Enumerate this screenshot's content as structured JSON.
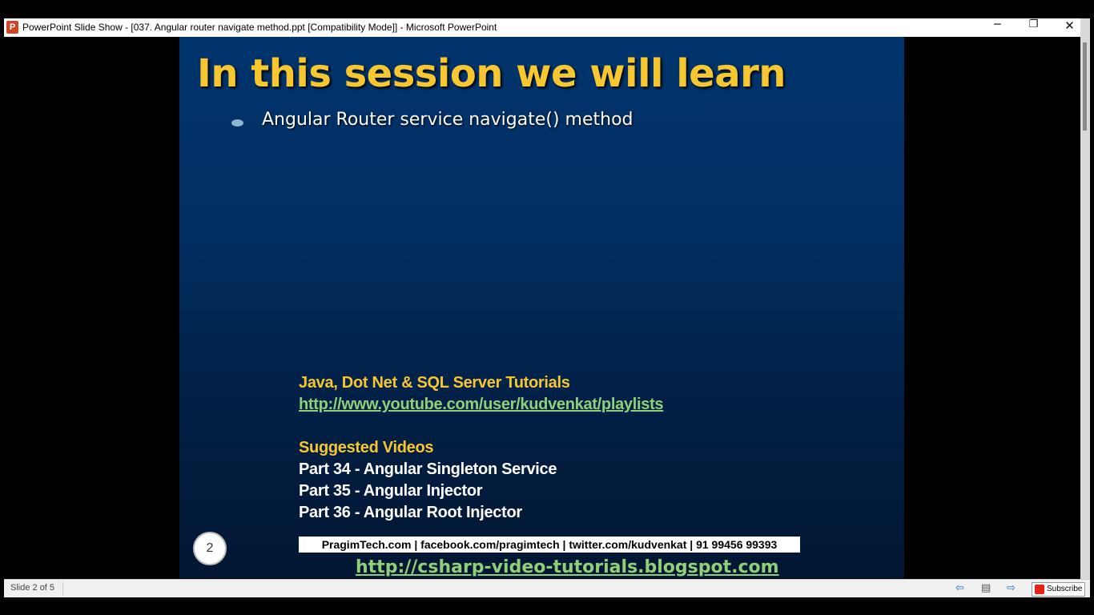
{
  "window": {
    "title": "PowerPoint Slide Show - [037. Angular router navigate method.ppt [Compatibility Mode]] - Microsoft PowerPoint",
    "icon_letter": "P",
    "minimize_glyph": "─",
    "maximize_glyph": "❐",
    "close_glyph": "✕"
  },
  "slide": {
    "title": "In this session we will learn",
    "bullets": [
      "Angular Router service navigate() method"
    ],
    "tutorials_heading": "Java, Dot Net & SQL Server Tutorials",
    "youtube_link": "http://www.youtube.com/user/kudvenkat/playlists",
    "suggested_heading": "Suggested Videos",
    "suggested": [
      "Part 34 - Angular Singleton Service",
      "Part 35 - Angular Injector",
      "Part 36 - Angular Root Injector"
    ],
    "number": "2",
    "contact_line": "PragimTech.com | facebook.com/pragimtech  | twitter.com/kudvenkat  | 91 99456 99393",
    "blog_link": "http://csharp-video-tutorials.blogspot.com"
  },
  "statusbar": {
    "slide_indicator": "Slide 2 of 5",
    "prev_glyph": "⇦",
    "menu_glyph": "▤",
    "next_glyph": "⇨",
    "subscribe_label": "Subscribe"
  },
  "colors": {
    "title_yellow": "#f6c731",
    "link_green": "#8ed178",
    "slide_background": "#022e62"
  }
}
